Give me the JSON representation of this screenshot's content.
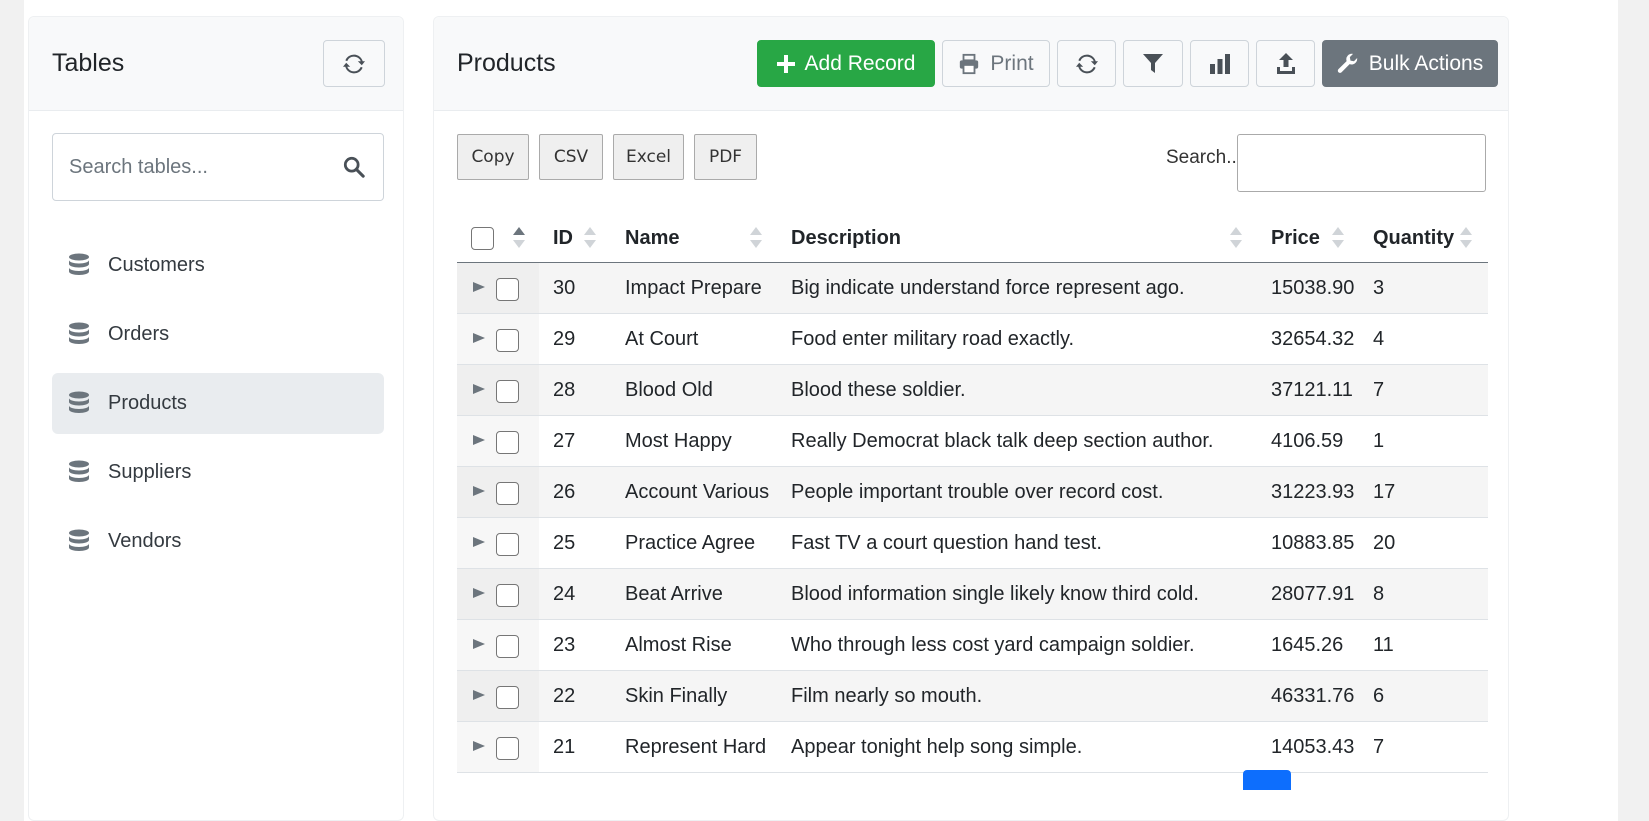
{
  "sidebar": {
    "title": "Tables",
    "search_placeholder": "Search tables...",
    "items": [
      {
        "label": "Customers",
        "active": false
      },
      {
        "label": "Orders",
        "active": false
      },
      {
        "label": "Products",
        "active": true
      },
      {
        "label": "Suppliers",
        "active": false
      },
      {
        "label": "Vendors",
        "active": false
      }
    ]
  },
  "main": {
    "title": "Products",
    "toolbar": {
      "add_label": "Add Record",
      "print_label": "Print",
      "bulk_label": "Bulk Actions"
    },
    "export_buttons": [
      "Copy",
      "CSV",
      "Excel",
      "PDF"
    ],
    "search_label": "Search...",
    "search_value": ""
  },
  "table": {
    "columns": [
      "ID",
      "Name",
      "Description",
      "Price",
      "Quantity"
    ],
    "rows": [
      {
        "id": "30",
        "name": "Impact Prepare",
        "description": "Big indicate understand force represent ago.",
        "price": "15038.90",
        "quantity": "3"
      },
      {
        "id": "29",
        "name": "At Court",
        "description": "Food enter military road exactly.",
        "price": "32654.32",
        "quantity": "4"
      },
      {
        "id": "28",
        "name": "Blood Old",
        "description": "Blood these soldier.",
        "price": "37121.11",
        "quantity": "7"
      },
      {
        "id": "27",
        "name": "Most Happy",
        "description": "Really Democrat black talk deep section author.",
        "price": "4106.59",
        "quantity": "1"
      },
      {
        "id": "26",
        "name": "Account Various",
        "description": "People important trouble over record cost.",
        "price": "31223.93",
        "quantity": "17"
      },
      {
        "id": "25",
        "name": "Practice Agree",
        "description": "Fast TV a court question hand test.",
        "price": "10883.85",
        "quantity": "20"
      },
      {
        "id": "24",
        "name": "Beat Arrive",
        "description": "Blood information single likely know third cold.",
        "price": "28077.91",
        "quantity": "8"
      },
      {
        "id": "23",
        "name": "Almost Rise",
        "description": "Who through less cost yard campaign soldier.",
        "price": "1645.26",
        "quantity": "11"
      },
      {
        "id": "22",
        "name": "Skin Finally",
        "description": "Film nearly so mouth.",
        "price": "46331.76",
        "quantity": "6"
      },
      {
        "id": "21",
        "name": "Represent Hard",
        "description": "Appear tonight help song simple.",
        "price": "14053.43",
        "quantity": "7"
      }
    ]
  },
  "colors": {
    "success": "#28a745",
    "secondary": "#6c757d",
    "primary": "#0d6efd"
  }
}
